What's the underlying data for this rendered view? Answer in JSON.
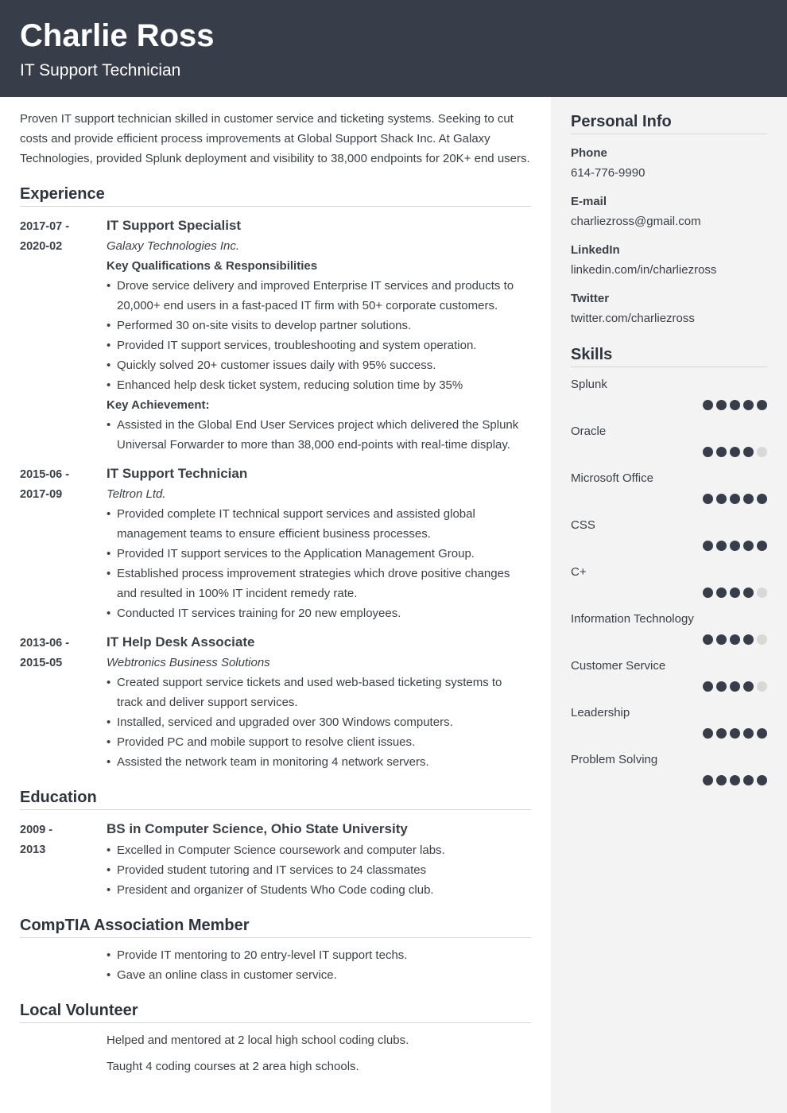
{
  "header": {
    "name": "Charlie Ross",
    "role": "IT Support Technician"
  },
  "summary": "Proven IT support technician skilled in customer service and ticketing systems. Seeking to cut costs and provide efficient process improvements at Global Support Shack Inc. At Galaxy Technologies, provided Splunk deployment and visibility to 38,000 endpoints for 20K+ end users.",
  "experience": {
    "title": "Experience",
    "entries": [
      {
        "date_start": "2017-07 -",
        "date_end": "2020-02",
        "title": "IT Support Specialist",
        "company": "Galaxy Technologies Inc.",
        "qualifications_heading": "Key Qualifications & Responsibilities",
        "bullets": [
          "Drove service delivery and improved Enterprise IT services and products to 20,000+ end users in a fast-paced IT firm with 50+ corporate customers.",
          "Performed 30 on-site visits to develop partner solutions.",
          "Provided IT support services, troubleshooting and system operation.",
          "Quickly solved 20+ customer issues daily with 95% success.",
          "Enhanced help desk ticket system, reducing solution time by 35%"
        ],
        "achievement_heading": "Key Achievement:",
        "achievements": [
          "Assisted in the Global End User Services project which delivered the Splunk Universal Forwarder to more than 38,000 end-points with real-time display."
        ]
      },
      {
        "date_start": "2015-06 -",
        "date_end": "2017-09",
        "title": "IT Support Technician",
        "company": "Teltron Ltd.",
        "bullets": [
          "Provided complete IT technical support services and assisted global management teams to ensure efficient business processes.",
          "Provided IT support services to the Application Management Group.",
          "Established process improvement strategies which drove positive changes and resulted in 100% IT incident remedy rate.",
          "Conducted IT services training for 20 new employees."
        ]
      },
      {
        "date_start": "2013-06 -",
        "date_end": "2015-05",
        "title": "IT Help Desk Associate",
        "company": "Webtronics Business Solutions",
        "bullets": [
          "Created support service tickets and used web-based ticketing systems to track and deliver support services.",
          "Installed, serviced and upgraded over 300 Windows computers.",
          "Provided PC and mobile support to resolve client issues.",
          "Assisted the network team in monitoring 4 network servers."
        ]
      }
    ]
  },
  "education": {
    "title": "Education",
    "date_start": "2009 -",
    "date_end": "2013",
    "degree": "BS in Computer Science, Ohio State University",
    "bullets": [
      "Excelled in Computer Science coursework and computer labs.",
      "Provided student tutoring and IT services to 24 classmates",
      "President and organizer of Students Who Code coding club."
    ]
  },
  "comptia": {
    "title": "CompTIA Association Member",
    "bullets": [
      "Provide IT mentoring to 20 entry-level IT support techs.",
      "Gave an online class in customer service."
    ]
  },
  "volunteer": {
    "title": "Local Volunteer",
    "lines": [
      "Helped and mentored at 2 local high school coding clubs.",
      "Taught 4 coding courses at 2 area high schools."
    ]
  },
  "personal_info": {
    "title": "Personal Info",
    "items": [
      {
        "label": "Phone",
        "value": "614-776-9990"
      },
      {
        "label": "E-mail",
        "value": "charliezross@gmail.com"
      },
      {
        "label": "LinkedIn",
        "value": "linkedin.com/in/charliezross"
      },
      {
        "label": "Twitter",
        "value": "twitter.com/charliezross"
      }
    ]
  },
  "skills": {
    "title": "Skills",
    "max_rating": 5,
    "items": [
      {
        "name": "Splunk",
        "rating": 5
      },
      {
        "name": "Oracle",
        "rating": 4
      },
      {
        "name": "Microsoft Office",
        "rating": 5
      },
      {
        "name": "CSS",
        "rating": 5
      },
      {
        "name": "C+",
        "rating": 4
      },
      {
        "name": "Information Technology",
        "rating": 4
      },
      {
        "name": "Customer Service",
        "rating": 4
      },
      {
        "name": "Leadership",
        "rating": 5
      },
      {
        "name": "Problem Solving",
        "rating": 5
      }
    ]
  },
  "colors": {
    "header_bg": "#383d4a",
    "sidebar_bg": "#f3f3f3",
    "dot_filled": "#383d4a",
    "dot_empty": "#d8d8d8"
  }
}
